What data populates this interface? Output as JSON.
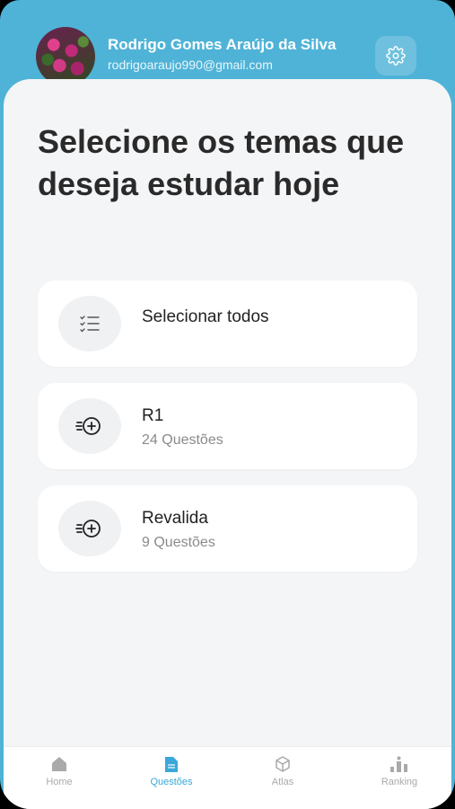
{
  "header": {
    "user_name": "Rodrigo Gomes Araújo da Silva",
    "user_email": "rodrigoaraujo990@gmail.com"
  },
  "main": {
    "title": "Selecione os temas que deseja estudar hoje",
    "select_all_label": "Selecionar todos",
    "themes": [
      {
        "name": "R1",
        "count": "24 Questões"
      },
      {
        "name": "Revalida",
        "count": "9 Questões"
      }
    ]
  },
  "nav": {
    "items": [
      {
        "label": "Home",
        "icon": "home-icon"
      },
      {
        "label": "Questões",
        "icon": "document-icon",
        "active": true
      },
      {
        "label": "Atlas",
        "icon": "cube-icon"
      },
      {
        "label": "Ranking",
        "icon": "ranking-icon"
      }
    ]
  },
  "colors": {
    "header_bg": "#4fb3d7",
    "active_nav": "#3aa8d8",
    "sheet_bg": "#f4f5f7"
  }
}
